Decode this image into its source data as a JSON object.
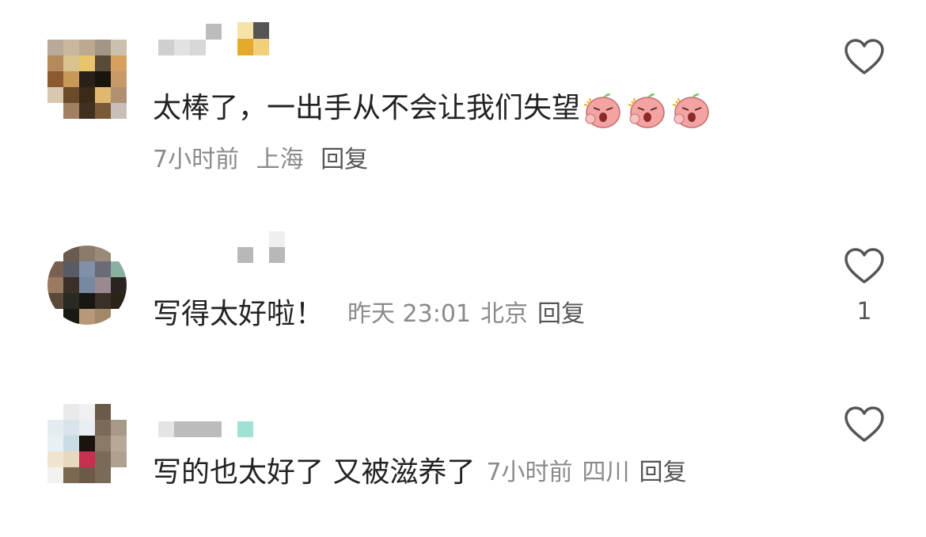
{
  "comments": [
    {
      "text": "太棒了，一出手从不会让我们失望",
      "emoji_count": 3,
      "emoji_name": "angry-peach-emoji",
      "time": "7小时前",
      "location": "上海",
      "reply_label": "回复",
      "likes": ""
    },
    {
      "text": "写得太好啦！",
      "time": "昨天 23:01",
      "location": "北京",
      "reply_label": "回复",
      "likes": "1"
    },
    {
      "text": "写的也太好了 又被滋养了",
      "time": "7小时前",
      "location": "四川",
      "reply_label": "回复",
      "likes": ""
    }
  ],
  "icons": {
    "like": "heart-outline-icon"
  },
  "colors": {
    "text_primary": "#222222",
    "text_meta": "#8a8a8a",
    "icon_stroke": "#555555"
  }
}
